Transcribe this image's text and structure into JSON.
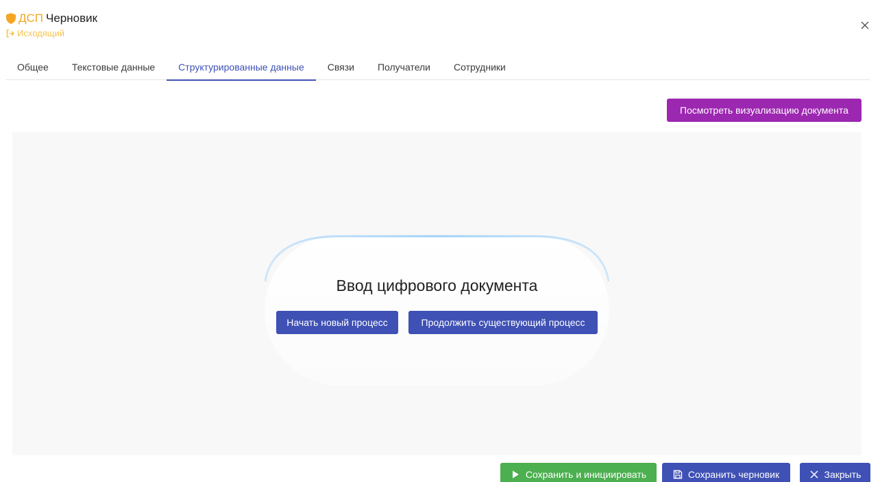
{
  "header": {
    "badge": "ДСП",
    "title": "Черновик",
    "direction": "Исходящий",
    "icons": [
      "shield-icon",
      "outgoing-arrow-icon",
      "close-icon"
    ]
  },
  "tabs": [
    {
      "label": "Общее",
      "active": false
    },
    {
      "label": "Текстовые данные",
      "active": false
    },
    {
      "label": "Структурированные данные",
      "active": true
    },
    {
      "label": "Связи",
      "active": false
    },
    {
      "label": "Получатели",
      "active": false
    },
    {
      "label": "Сотрудники",
      "active": false
    }
  ],
  "toolbar": {
    "visualize_label": "Посмотреть визуализацию документа"
  },
  "digital_input": {
    "title": "Ввод цифрового документа",
    "start_new_label": "Начать новый процесс",
    "continue_label": "Продолжить существующий процесс"
  },
  "footer": {
    "save_init_label": "Сохранить и инициировать",
    "save_draft_label": "Сохранить черновик",
    "close_label": "Закрыть"
  },
  "colors": {
    "accent_blue": "#3f51b5",
    "purple": "#9c27b0",
    "green": "#4caf50",
    "badge_orange": "#f5a623"
  }
}
